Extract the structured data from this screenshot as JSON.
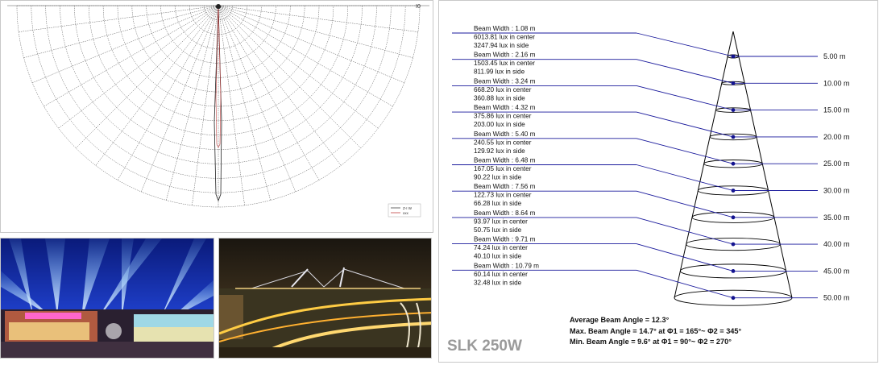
{
  "polar_chart": {
    "top_label": "I0",
    "legend": [
      "Z-I W",
      "xxx"
    ]
  },
  "photos": [
    {
      "name": "stadium-light-show-photo"
    },
    {
      "name": "bridge-night-photo"
    }
  ],
  "beam_diagram": {
    "levels": [
      {
        "distance": "5.00 m",
        "lines": [
          "Beam Width : 1.08 m",
          "6013.81 lux in center",
          "3247.94 lux in side"
        ]
      },
      {
        "distance": "10.00 m",
        "lines": [
          "Beam Width : 2.16 m",
          "1503.45 lux in center",
          "811.99 lux in side"
        ]
      },
      {
        "distance": "15.00 m",
        "lines": [
          "Beam Width : 3.24 m",
          "668.20 lux in center",
          "360.88 lux in side"
        ]
      },
      {
        "distance": "20.00 m",
        "lines": [
          "Beam Width : 4.32 m",
          "375.86 lux in center",
          "203.00 lux in side"
        ]
      },
      {
        "distance": "25.00 m",
        "lines": [
          "Beam Width : 5.40 m",
          "240.55 lux in center",
          "129.92 lux in side"
        ]
      },
      {
        "distance": "30.00 m",
        "lines": [
          "Beam Width : 6.48 m",
          "167.05 lux in center",
          "90.22 lux in side"
        ]
      },
      {
        "distance": "35.00 m",
        "lines": [
          "Beam Width : 7.56 m",
          "122.73 lux in center",
          "66.28 lux in side"
        ]
      },
      {
        "distance": "40.00 m",
        "lines": [
          "Beam Width : 8.64 m",
          "93.97 lux in center",
          "50.75 lux in side"
        ]
      },
      {
        "distance": "45.00 m",
        "lines": [
          "Beam Width : 9.71 m",
          "74.24 lux in center",
          "40.10 lux in side"
        ]
      },
      {
        "distance": "50.00 m",
        "lines": [
          "Beam Width : 10.79 m",
          "60.14 lux in center",
          "32.48 lux in side"
        ]
      }
    ],
    "angles": [
      "Average Beam Angle =  12.3°",
      "Max. Beam Angle = 14.7° at Φ1 = 165°~ Φ2 = 345°",
      "Min. Beam Angle = 9.6° at Φ1 = 90°~ Φ2 = 270°"
    ],
    "model": "SLK 250W"
  },
  "colors": {
    "leader_line": "#1a1a9c",
    "dot": "#10108a",
    "cone": "#000000",
    "model_text": "#9a9a9a"
  }
}
